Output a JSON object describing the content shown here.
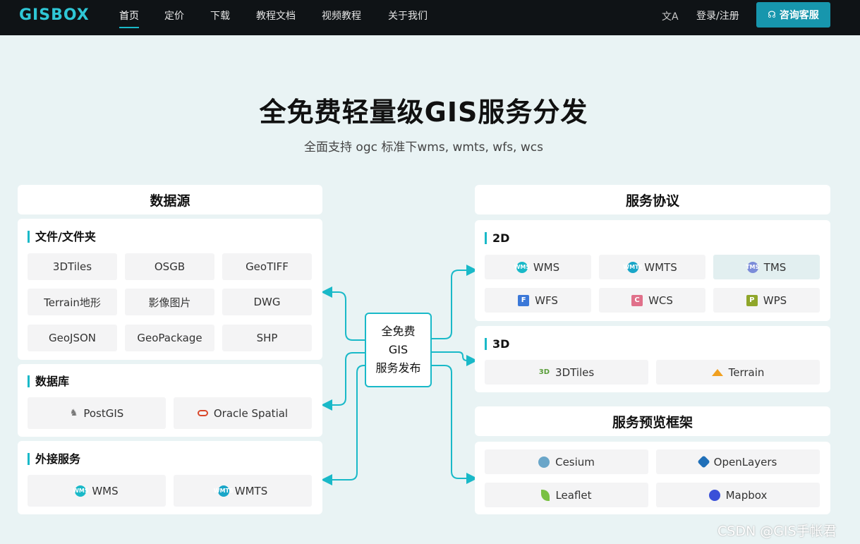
{
  "nav": {
    "logo": "GISBOX",
    "items": [
      "首页",
      "定价",
      "下载",
      "教程文档",
      "视频教程",
      "关于我们"
    ],
    "lang_icon": "文A",
    "login": "登录/注册",
    "consult": "咨询客服"
  },
  "hero": {
    "title": "全免费轻量级GIS服务分发",
    "subtitle": "全面支持 ogc 标准下wms, wmts, wfs, wcs"
  },
  "left": {
    "title": "数据源",
    "files": {
      "title": "文件/文件夹",
      "items": [
        "3DTiles",
        "OSGB",
        "GeoTIFF",
        "Terrain地形",
        "影像图片",
        "DWG",
        "GeoJSON",
        "GeoPackage",
        "SHP"
      ]
    },
    "db": {
      "title": "数据库",
      "items": [
        "PostGIS",
        "Oracle Spatial"
      ]
    },
    "ext": {
      "title": "外接服务",
      "items": [
        "WMS",
        "WMTS"
      ]
    }
  },
  "center": {
    "line1": "全免费",
    "line2": "GIS",
    "line3": "服务发布"
  },
  "right": {
    "title": "服务协议",
    "d2": {
      "title": "2D",
      "items": [
        "WMS",
        "WMTS",
        "TMS",
        "WFS",
        "WCS",
        "WPS"
      ]
    },
    "d3": {
      "title": "3D",
      "items": [
        "3DTiles",
        "Terrain"
      ]
    },
    "frame_title": "服务预览框架",
    "frames": [
      "Cesium",
      "OpenLayers",
      "Leaflet",
      "Mapbox"
    ]
  },
  "icons": {
    "wms": "WMS",
    "wmts": "WMTS",
    "tms": "TMS",
    "wfs": "F",
    "wcs": "C",
    "wps": "P",
    "tiles3d": "3D"
  },
  "colors": {
    "accent": "#19b9c8",
    "consult_bg": "#1796ad",
    "nav_bg": "#0f1316"
  },
  "watermark": "CSDN @GIS手帐君"
}
